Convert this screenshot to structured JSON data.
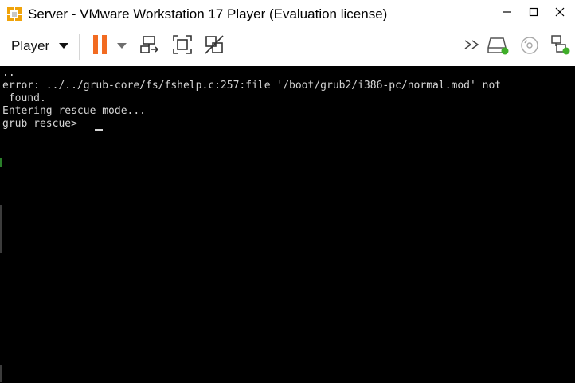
{
  "window": {
    "title": "Server - VMware Workstation 17 Player (Evaluation license)",
    "controls": {
      "minimize": "minimize-icon",
      "maximize": "maximize-icon",
      "close": "close-icon"
    }
  },
  "toolbar": {
    "player_menu_label": "Player",
    "icons_left": [
      "pause-icon",
      "dropdown-caret-icon",
      "send-ctrl-alt-del-icon",
      "fit-guest-icon",
      "unity-icon"
    ],
    "icons_right": [
      "more-chevrons-icon",
      "hard-disk-icon",
      "cd-dvd-icon",
      "network-adapter-icon"
    ]
  },
  "console": {
    "lines": [
      "..",
      "error: ../../grub-core/fs/fshelp.c:257:file '/boot/grub2/i386-pc/normal.mod' not",
      " found.",
      "Entering rescue mode...",
      "grub rescue> "
    ]
  },
  "colors": {
    "pause_orange": "#f26b21",
    "console_bg": "#000000",
    "console_text": "#d4d4d4",
    "status_green": "#3fae29"
  }
}
